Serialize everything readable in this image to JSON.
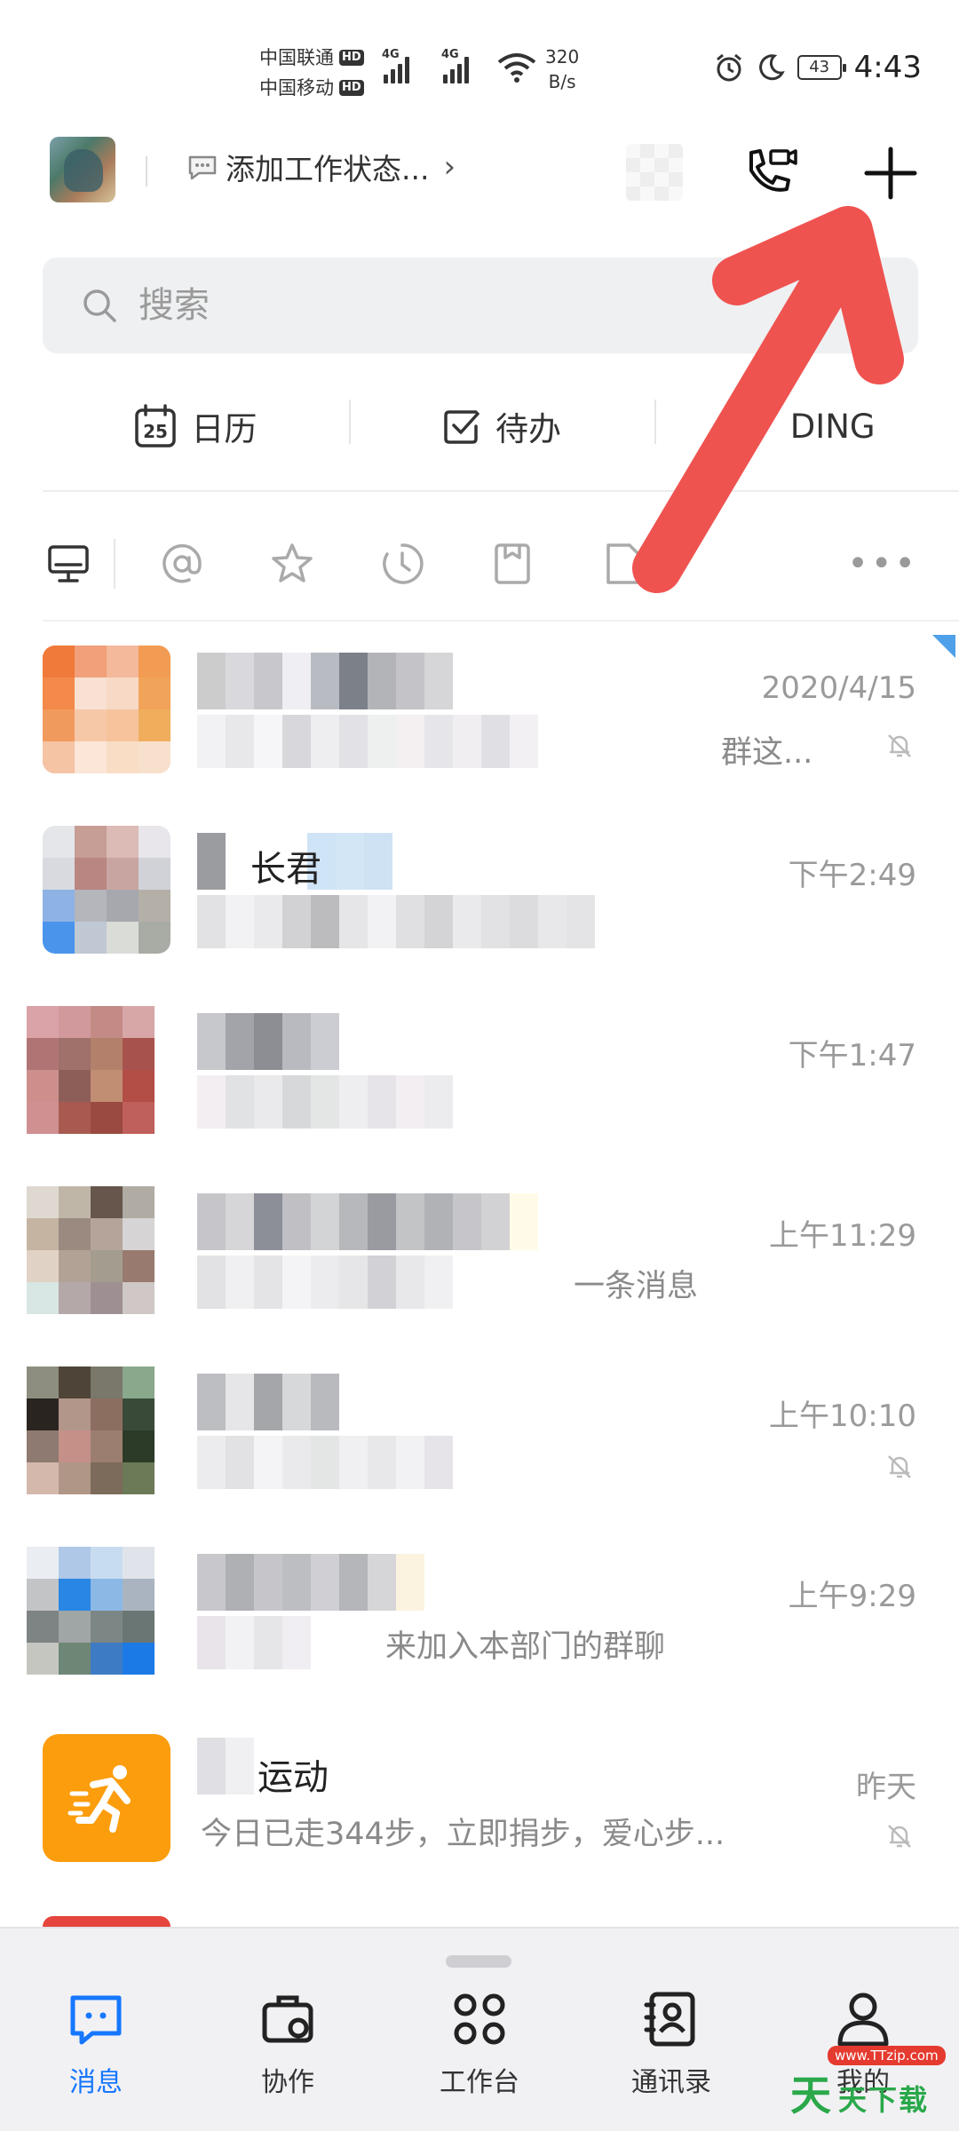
{
  "status_bar": {
    "carrier_1": "中国联通",
    "carrier_2": "中国移动",
    "hd_badge": "HD",
    "network_type": "4G",
    "net_speed_value": "320",
    "net_speed_unit": "B/s",
    "battery": "43",
    "time": "4:43"
  },
  "header": {
    "work_status": "添加工作状态..."
  },
  "search": {
    "placeholder": "搜索"
  },
  "shortcuts": {
    "calendar_day": "25",
    "calendar": "日历",
    "todo": "待办",
    "ding": "DING"
  },
  "conversations": [
    {
      "time": "2020/4/15",
      "visible_msg": "群这...",
      "muted": true
    },
    {
      "visible_name": "长君",
      "time": "下午2:49",
      "muted": false
    },
    {
      "time": "下午1:47",
      "muted": false
    },
    {
      "time": "上午11:29",
      "visible_msg": "一条消息",
      "muted": false
    },
    {
      "time": "上午10:10",
      "muted": true
    },
    {
      "time": "上午9:29",
      "visible_msg": "来加入本部门的群聊",
      "muted": false
    },
    {
      "visible_name": "运动",
      "time": "昨天",
      "visible_msg": "今日已走344步，立即捐步，爱心步...",
      "muted": true
    }
  ],
  "bottom_nav": {
    "items": [
      {
        "label": "消息",
        "active": true
      },
      {
        "label": "协作",
        "active": false
      },
      {
        "label": "工作台",
        "active": false
      },
      {
        "label": "通讯录",
        "active": false
      },
      {
        "label": "我的",
        "active": false
      }
    ]
  },
  "watermark": {
    "url": "www.TTzip.com",
    "brand_char": "天",
    "brand_text": "天下载"
  },
  "colors": {
    "accent": "#1677ff",
    "annotation_arrow": "#ef5350",
    "sport_avatar": "#fb9d0c"
  }
}
